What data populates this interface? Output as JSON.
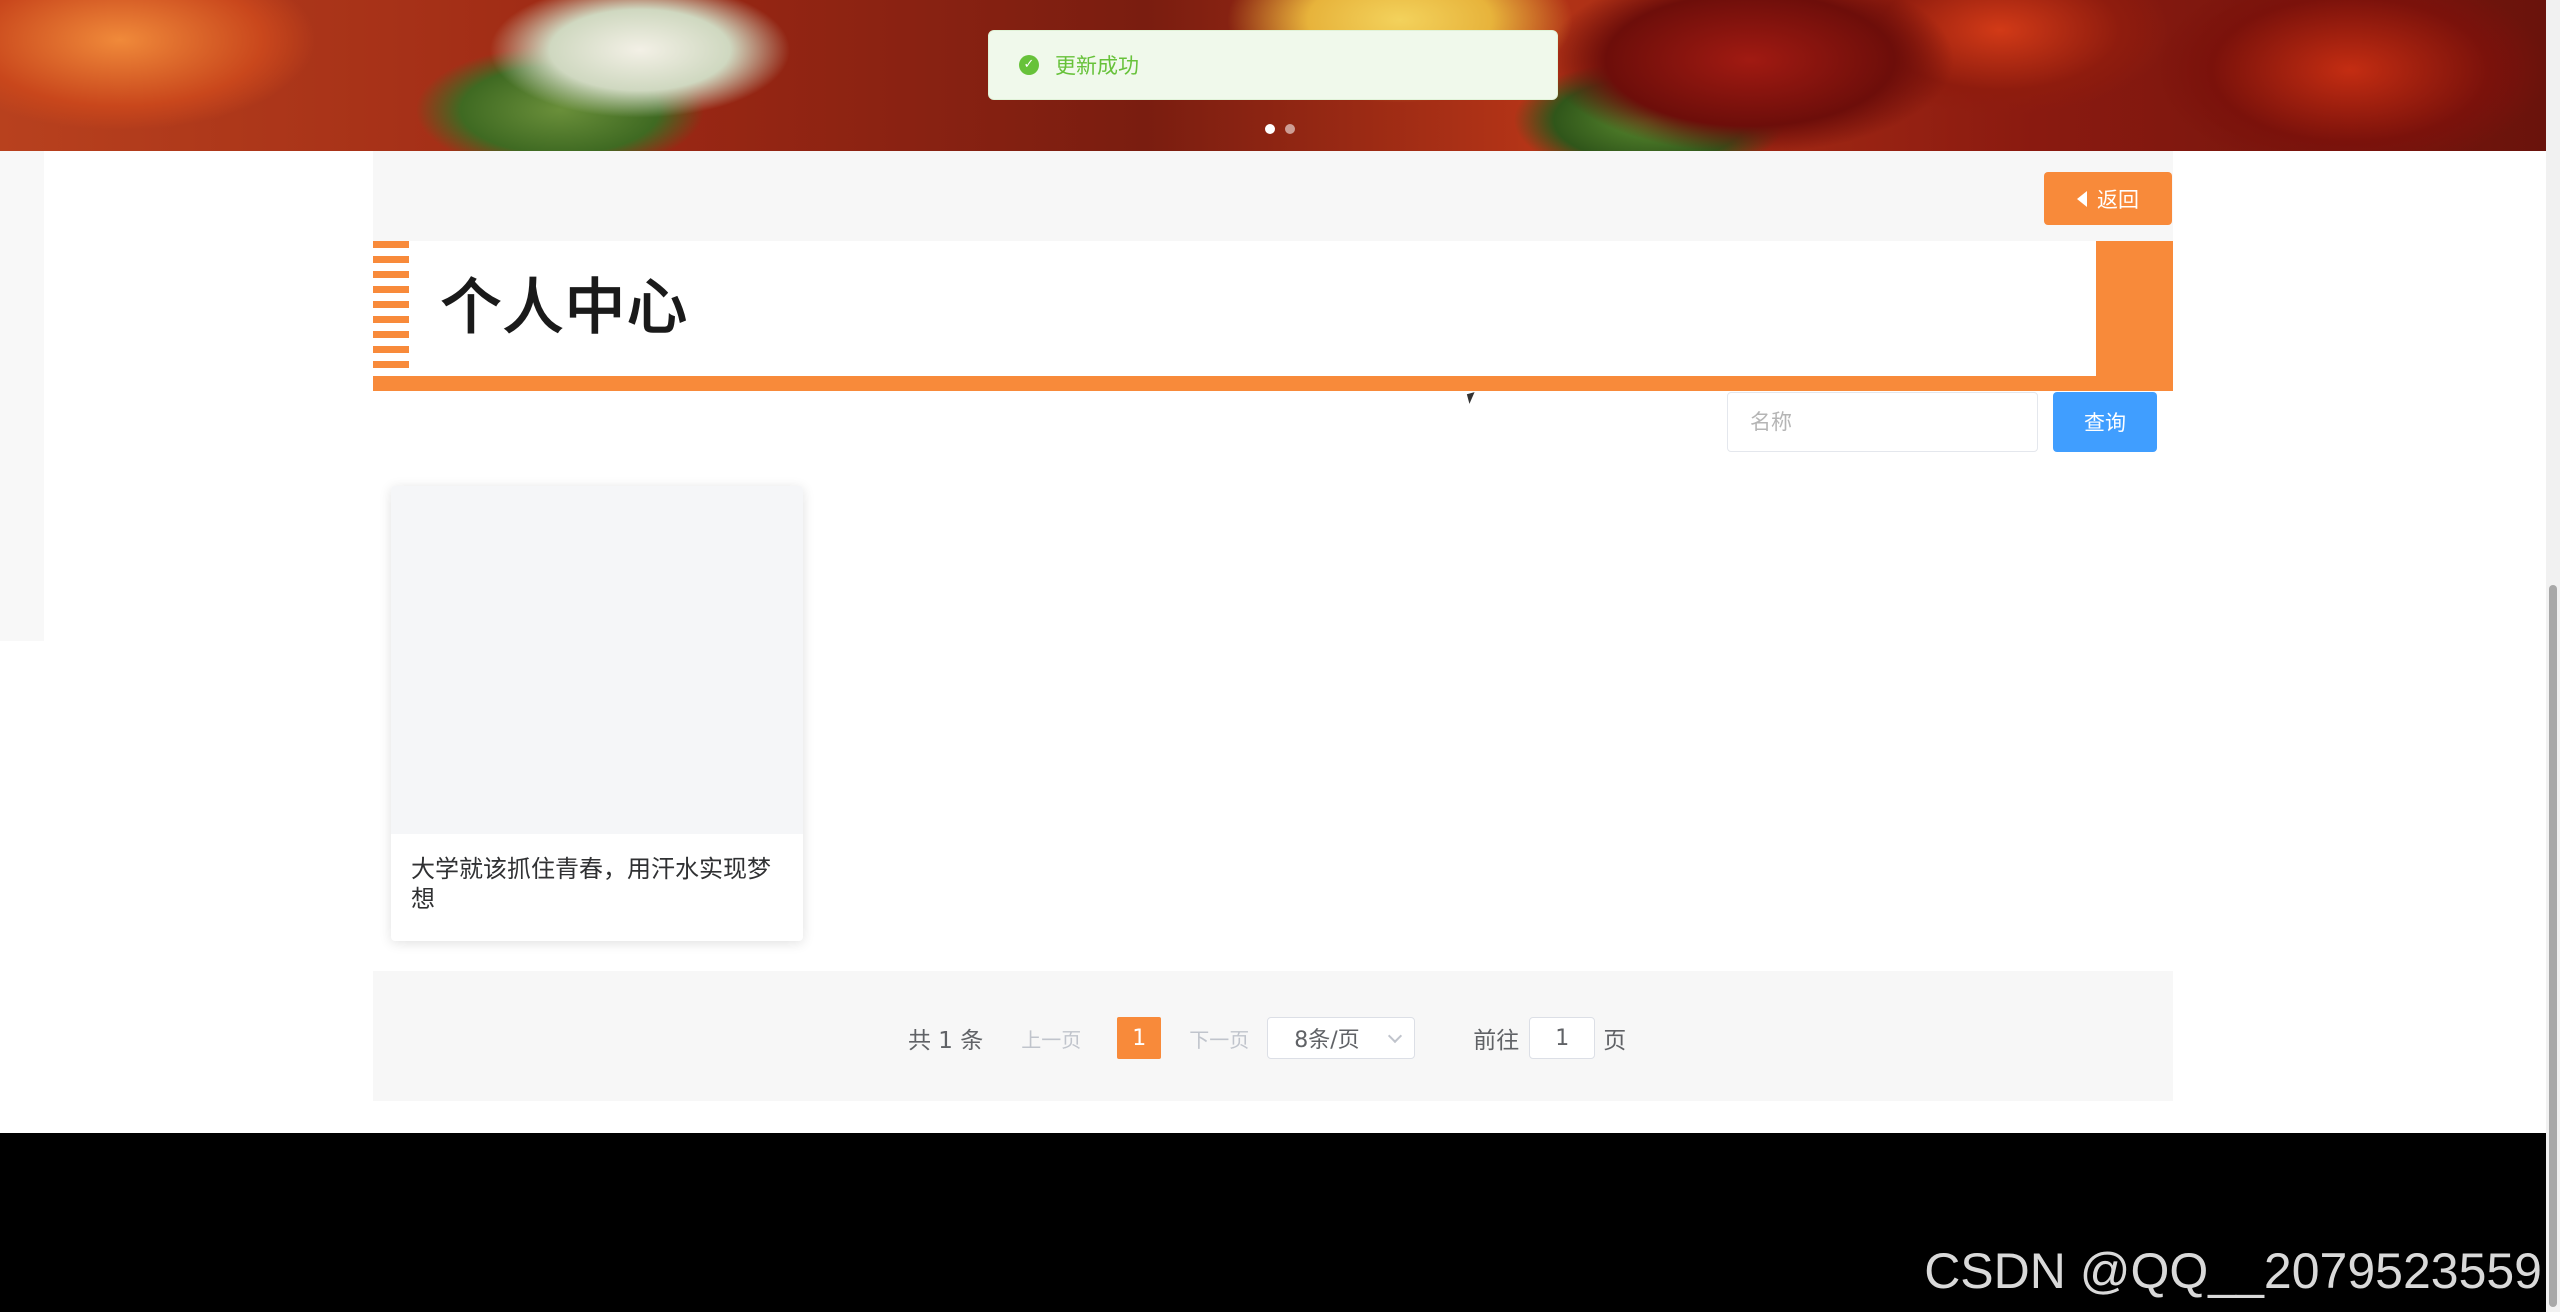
{
  "toast": {
    "message": "更新成功",
    "icon": "check-circle-icon",
    "color": "#67c23a"
  },
  "banner": {
    "dots": 2,
    "active_dot": 1
  },
  "header": {
    "back_label": "返回",
    "back_icon": "caret-left-icon"
  },
  "title": {
    "text": "个人中心",
    "accent_color": "#f88a3a"
  },
  "search": {
    "placeholder": "名称",
    "button_label": "查询",
    "button_color": "#409eff"
  },
  "cards": [
    {
      "name": "大学就该抓住青春，用汗水实现梦想"
    }
  ],
  "pagination": {
    "total_label": "共 1 条",
    "prev_label": "上一页",
    "current_page": "1",
    "next_label": "下一页",
    "page_size_label": "8条/页",
    "goto_prefix": "前往",
    "goto_value": "1",
    "goto_suffix": "页"
  },
  "footer": {
    "watermark": "CSDN @QQ__2079523559"
  }
}
